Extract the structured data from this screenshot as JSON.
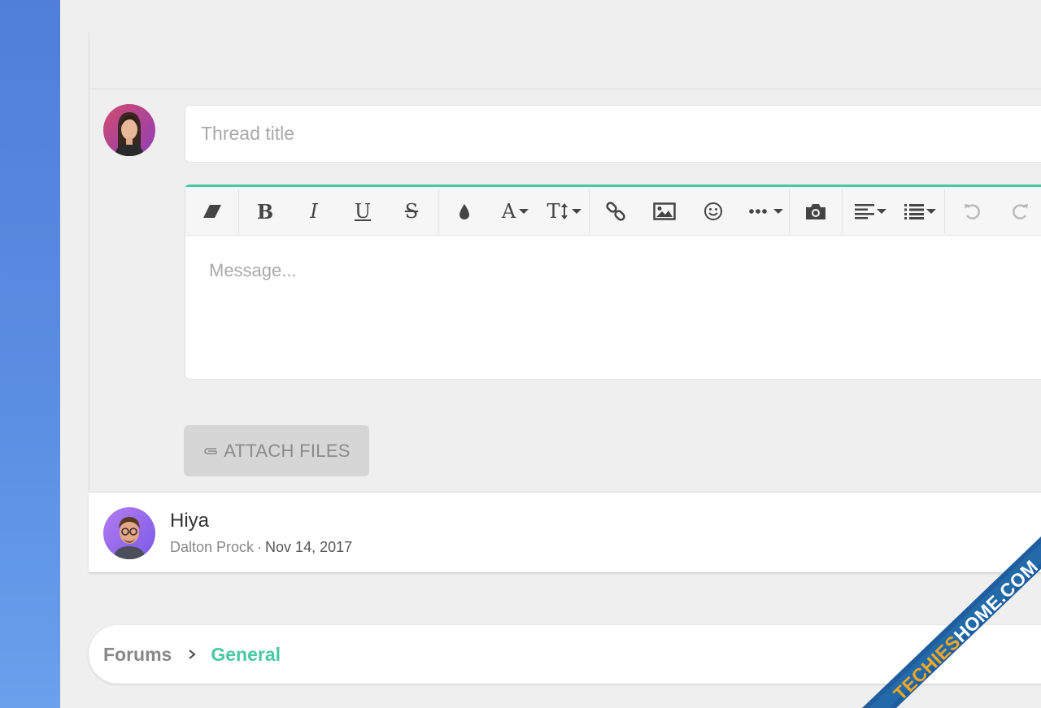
{
  "composer": {
    "title_placeholder": "Thread title",
    "message_placeholder": "Message...",
    "attach_label": "ATTACH FILES",
    "toolbar": {
      "bold": "B",
      "italic": "I",
      "underline": "U",
      "strike": "S",
      "font_color": "A",
      "font_size": "T",
      "icons": [
        "eraser-icon",
        "droplet-icon",
        "link-icon",
        "image-icon",
        "smiley-icon",
        "more-icon",
        "camera-icon",
        "align-icon",
        "list-icon",
        "undo-icon",
        "redo-icon"
      ]
    },
    "accent_color": "#47c9a2"
  },
  "thread": {
    "title": "Hiya",
    "author": "Dalton Prock",
    "separator": "·",
    "date": "Nov 14, 2017"
  },
  "breadcrumb": {
    "root": "Forums",
    "current": "General"
  },
  "watermark": {
    "text": "TECHIESHOME.COM"
  }
}
